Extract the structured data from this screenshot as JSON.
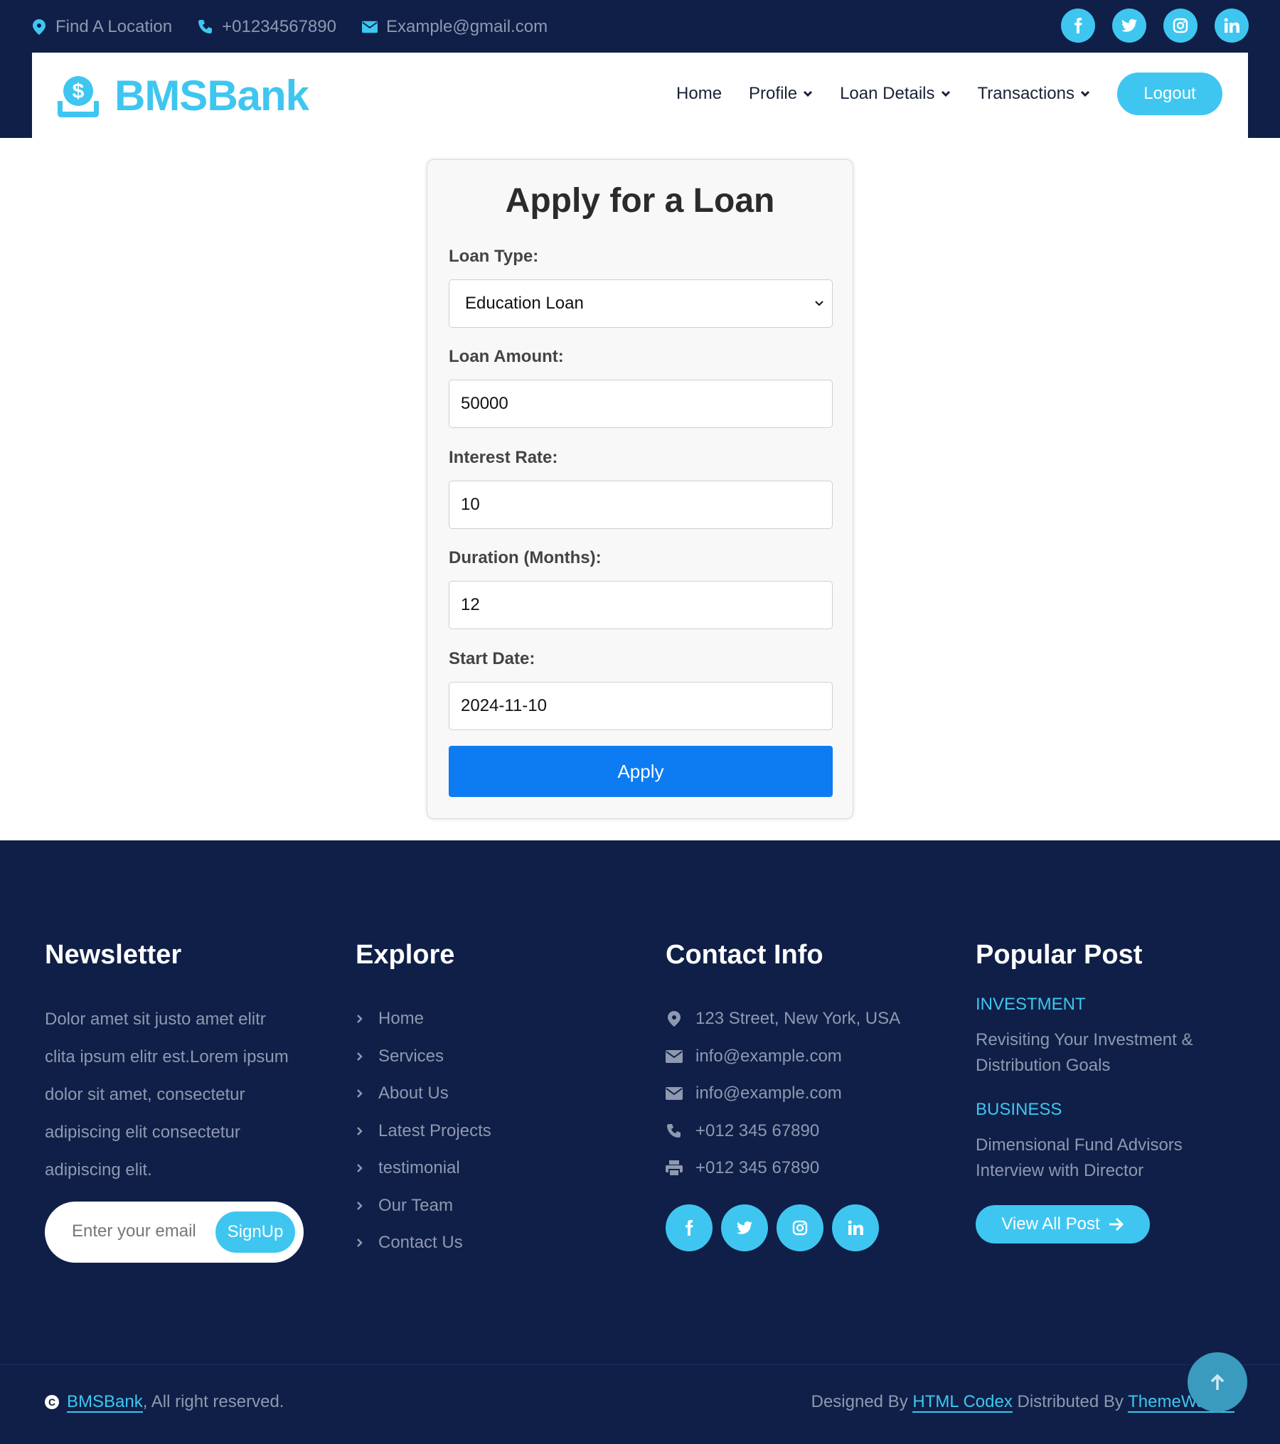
{
  "topbar": {
    "location": "Find A Location",
    "phone": "+01234567890",
    "email": "Example@gmail.com",
    "socials": [
      "facebook-icon",
      "twitter-icon",
      "instagram-icon",
      "linkedin-icon"
    ]
  },
  "nav": {
    "brand": "BMSBank",
    "items": [
      {
        "label": "Home",
        "dropdown": false
      },
      {
        "label": "Profile",
        "dropdown": true
      },
      {
        "label": "Loan Details",
        "dropdown": true
      },
      {
        "label": "Transactions",
        "dropdown": true
      }
    ],
    "logout": "Logout"
  },
  "form": {
    "title": "Apply for a Loan",
    "loan_type_label": "Loan Type:",
    "loan_type_value": "Education Loan",
    "amount_label": "Loan Amount:",
    "amount_value": "50000",
    "interest_label": "Interest Rate:",
    "interest_value": "10",
    "duration_label": "Duration (Months):",
    "duration_value": "12",
    "start_label": "Start Date:",
    "start_value": "2024-11-10",
    "apply": "Apply"
  },
  "footer": {
    "newsletter": {
      "title": "Newsletter",
      "text": "Dolor amet sit justo amet elitr clita ipsum elitr est.Lorem ipsum dolor sit amet, consectetur adipiscing elit consectetur adipiscing elit.",
      "placeholder": "Enter your email",
      "button": "SignUp"
    },
    "explore": {
      "title": "Explore",
      "links": [
        "Home",
        "Services",
        "About Us",
        "Latest Projects",
        "testimonial",
        "Our Team",
        "Contact Us"
      ]
    },
    "contact": {
      "title": "Contact Info",
      "address": "123 Street, New York, USA",
      "email1": "info@example.com",
      "email2": "info@example.com",
      "phone": "+012 345 67890",
      "fax": "+012 345 67890"
    },
    "popular": {
      "title": "Popular Post",
      "posts": [
        {
          "category": "INVESTMENT",
          "title": "Revisiting Your Investment & Distribution Goals"
        },
        {
          "category": "BUSINESS",
          "title": "Dimensional Fund Advisors Interview with Director"
        }
      ],
      "view_all": "View All Post"
    },
    "bottom": {
      "brand": "BMSBank",
      "rights": ", All right reserved.",
      "designed_by": "Designed By ",
      "designer": "HTML Codex",
      "distributed_by": " Distributed By ",
      "distributor": "ThemeWagon"
    }
  },
  "colors": {
    "navy": "#0f1f47",
    "accent": "#3ec6f0",
    "primary_button": "#0d7cf2"
  }
}
